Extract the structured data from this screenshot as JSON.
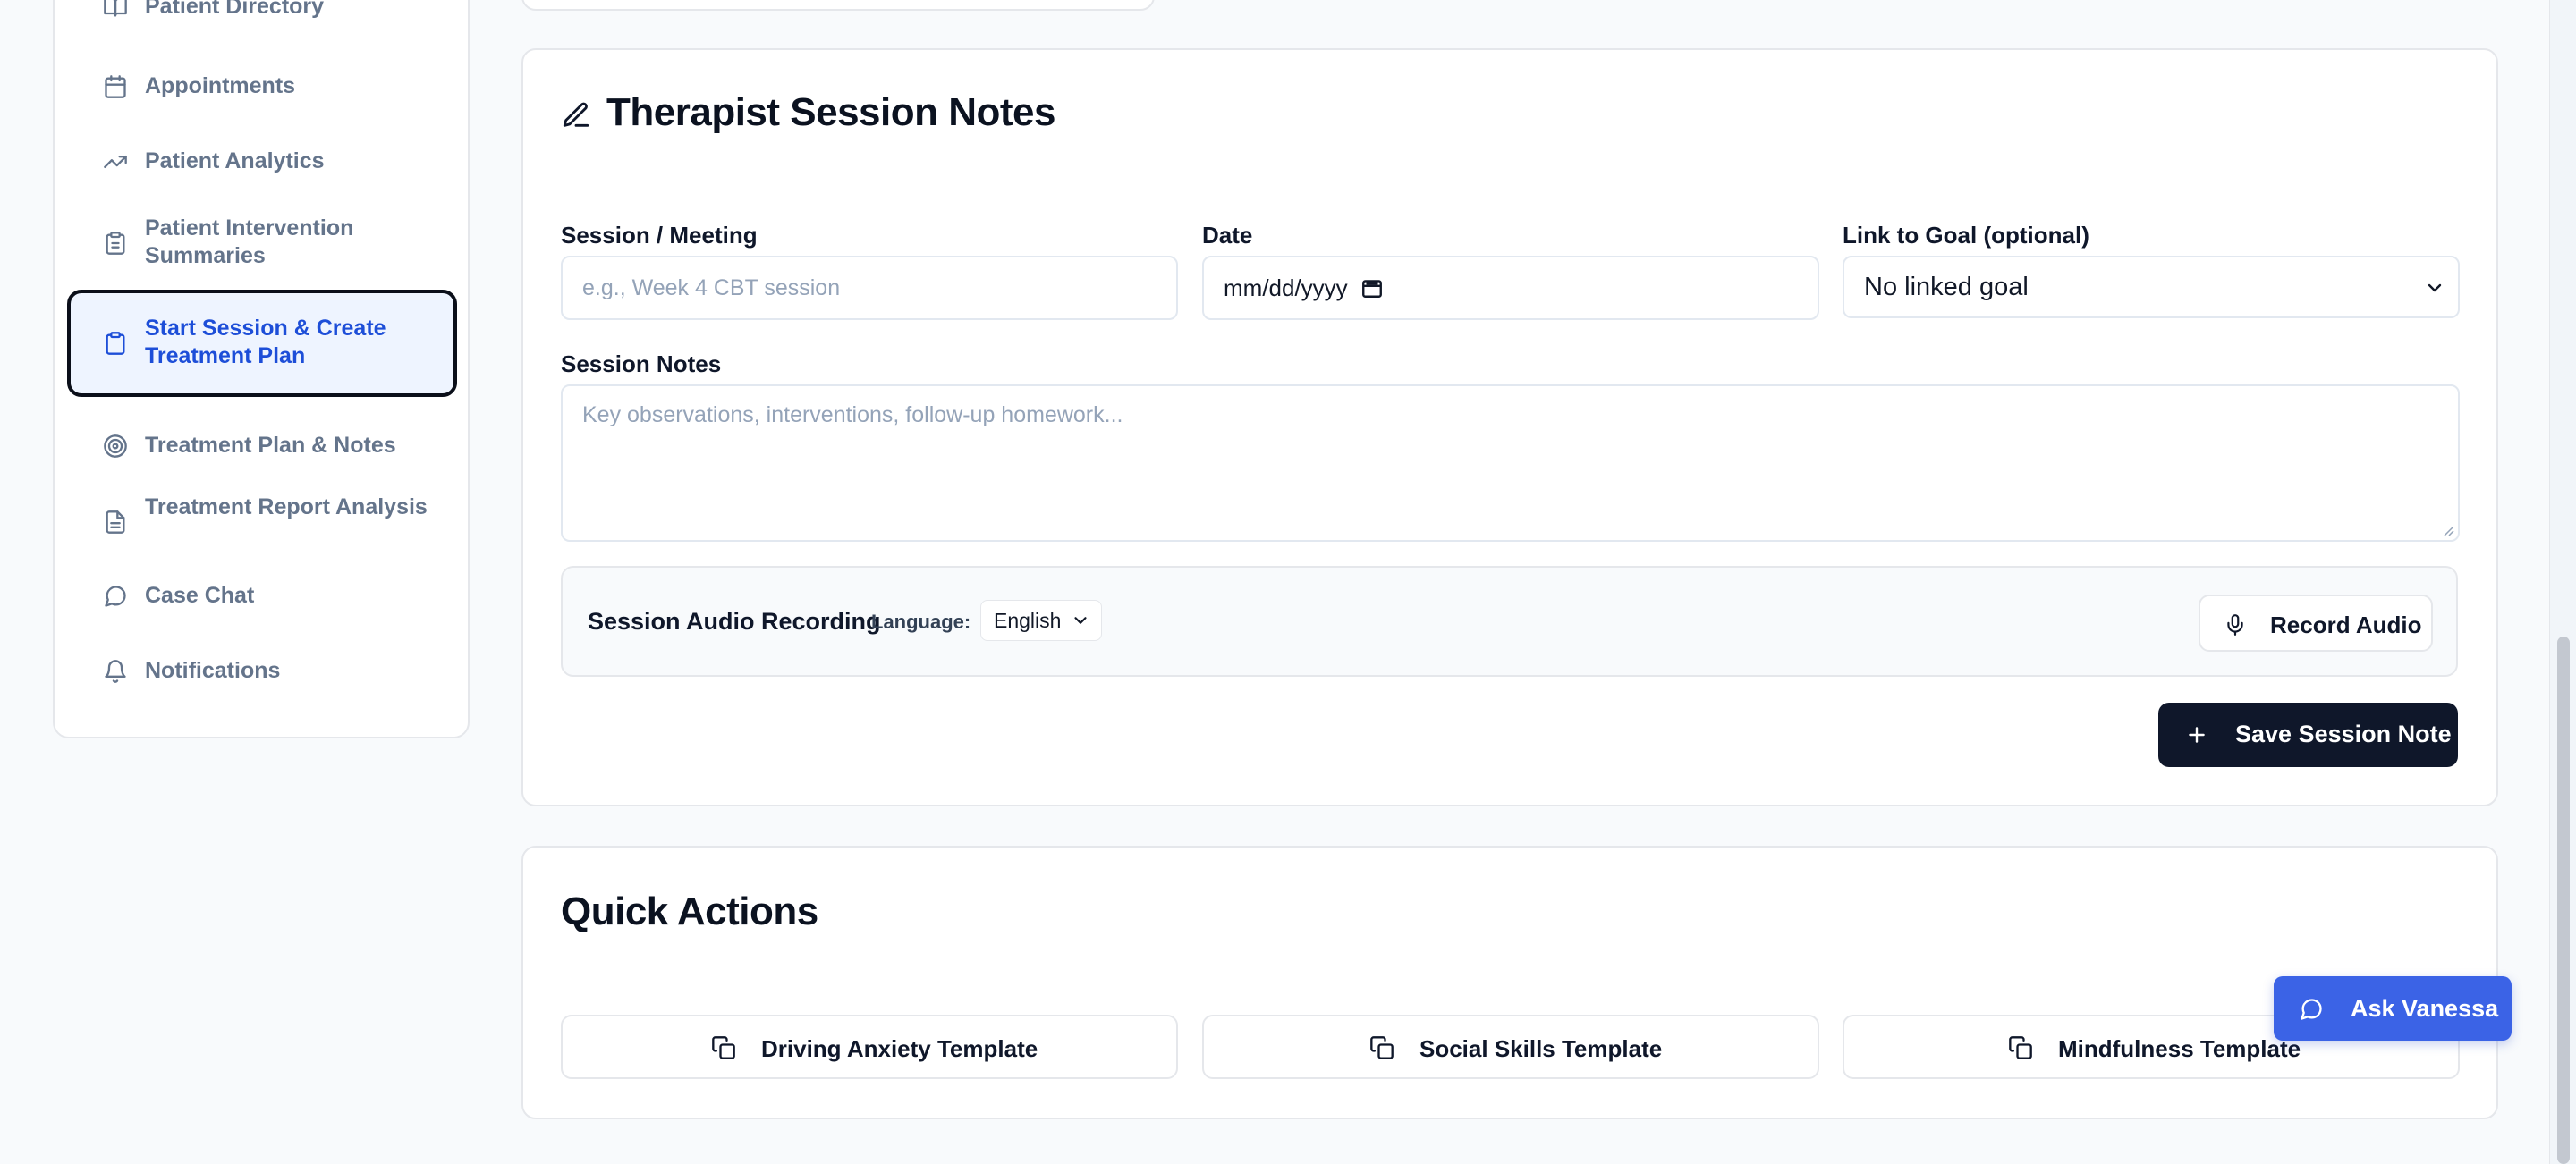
{
  "sidebar": {
    "items": [
      {
        "label": "Patient Directory",
        "icon": "book-icon"
      },
      {
        "label": "Appointments",
        "icon": "calendar-icon"
      },
      {
        "label": "Patient Analytics",
        "icon": "trending-up-icon"
      },
      {
        "label": "Patient Intervention Summaries",
        "icon": "clipboard-icon"
      },
      {
        "label": "Start Session & Create Treatment Plan",
        "icon": "clipboard-icon",
        "active": true
      },
      {
        "label": "Treatment Plan & Notes",
        "icon": "target-icon"
      },
      {
        "label": "Treatment Report Analysis",
        "icon": "file-text-icon"
      },
      {
        "label": "Case Chat",
        "icon": "message-circle-icon"
      },
      {
        "label": "Notifications",
        "icon": "bell-icon"
      }
    ]
  },
  "session_notes": {
    "title": "Therapist Session Notes",
    "session_label": "Session / Meeting",
    "session_placeholder": "e.g., Week 4 CBT session",
    "date_label": "Date",
    "date_placeholder": "mm/dd/yyyy",
    "goal_label": "Link to Goal (optional)",
    "goal_value": "No linked goal",
    "notes_label": "Session Notes",
    "notes_placeholder": "Key observations, interventions, follow-up homework...",
    "audio": {
      "title": "Session Audio Recording",
      "language_label": "Language:",
      "language_value": "English",
      "record_label": "Record Audio"
    },
    "save_label": "Save Session Note"
  },
  "quick_actions": {
    "title": "Quick Actions",
    "templates": [
      {
        "label": "Driving Anxiety Template"
      },
      {
        "label": "Social Skills Template"
      },
      {
        "label": "Mindfulness Template"
      }
    ]
  },
  "assistant": {
    "label": "Ask Vanessa"
  },
  "colors": {
    "accent": "#3b63e6",
    "active_nav": "#1d4ed8",
    "dark_button": "#0f172a"
  }
}
